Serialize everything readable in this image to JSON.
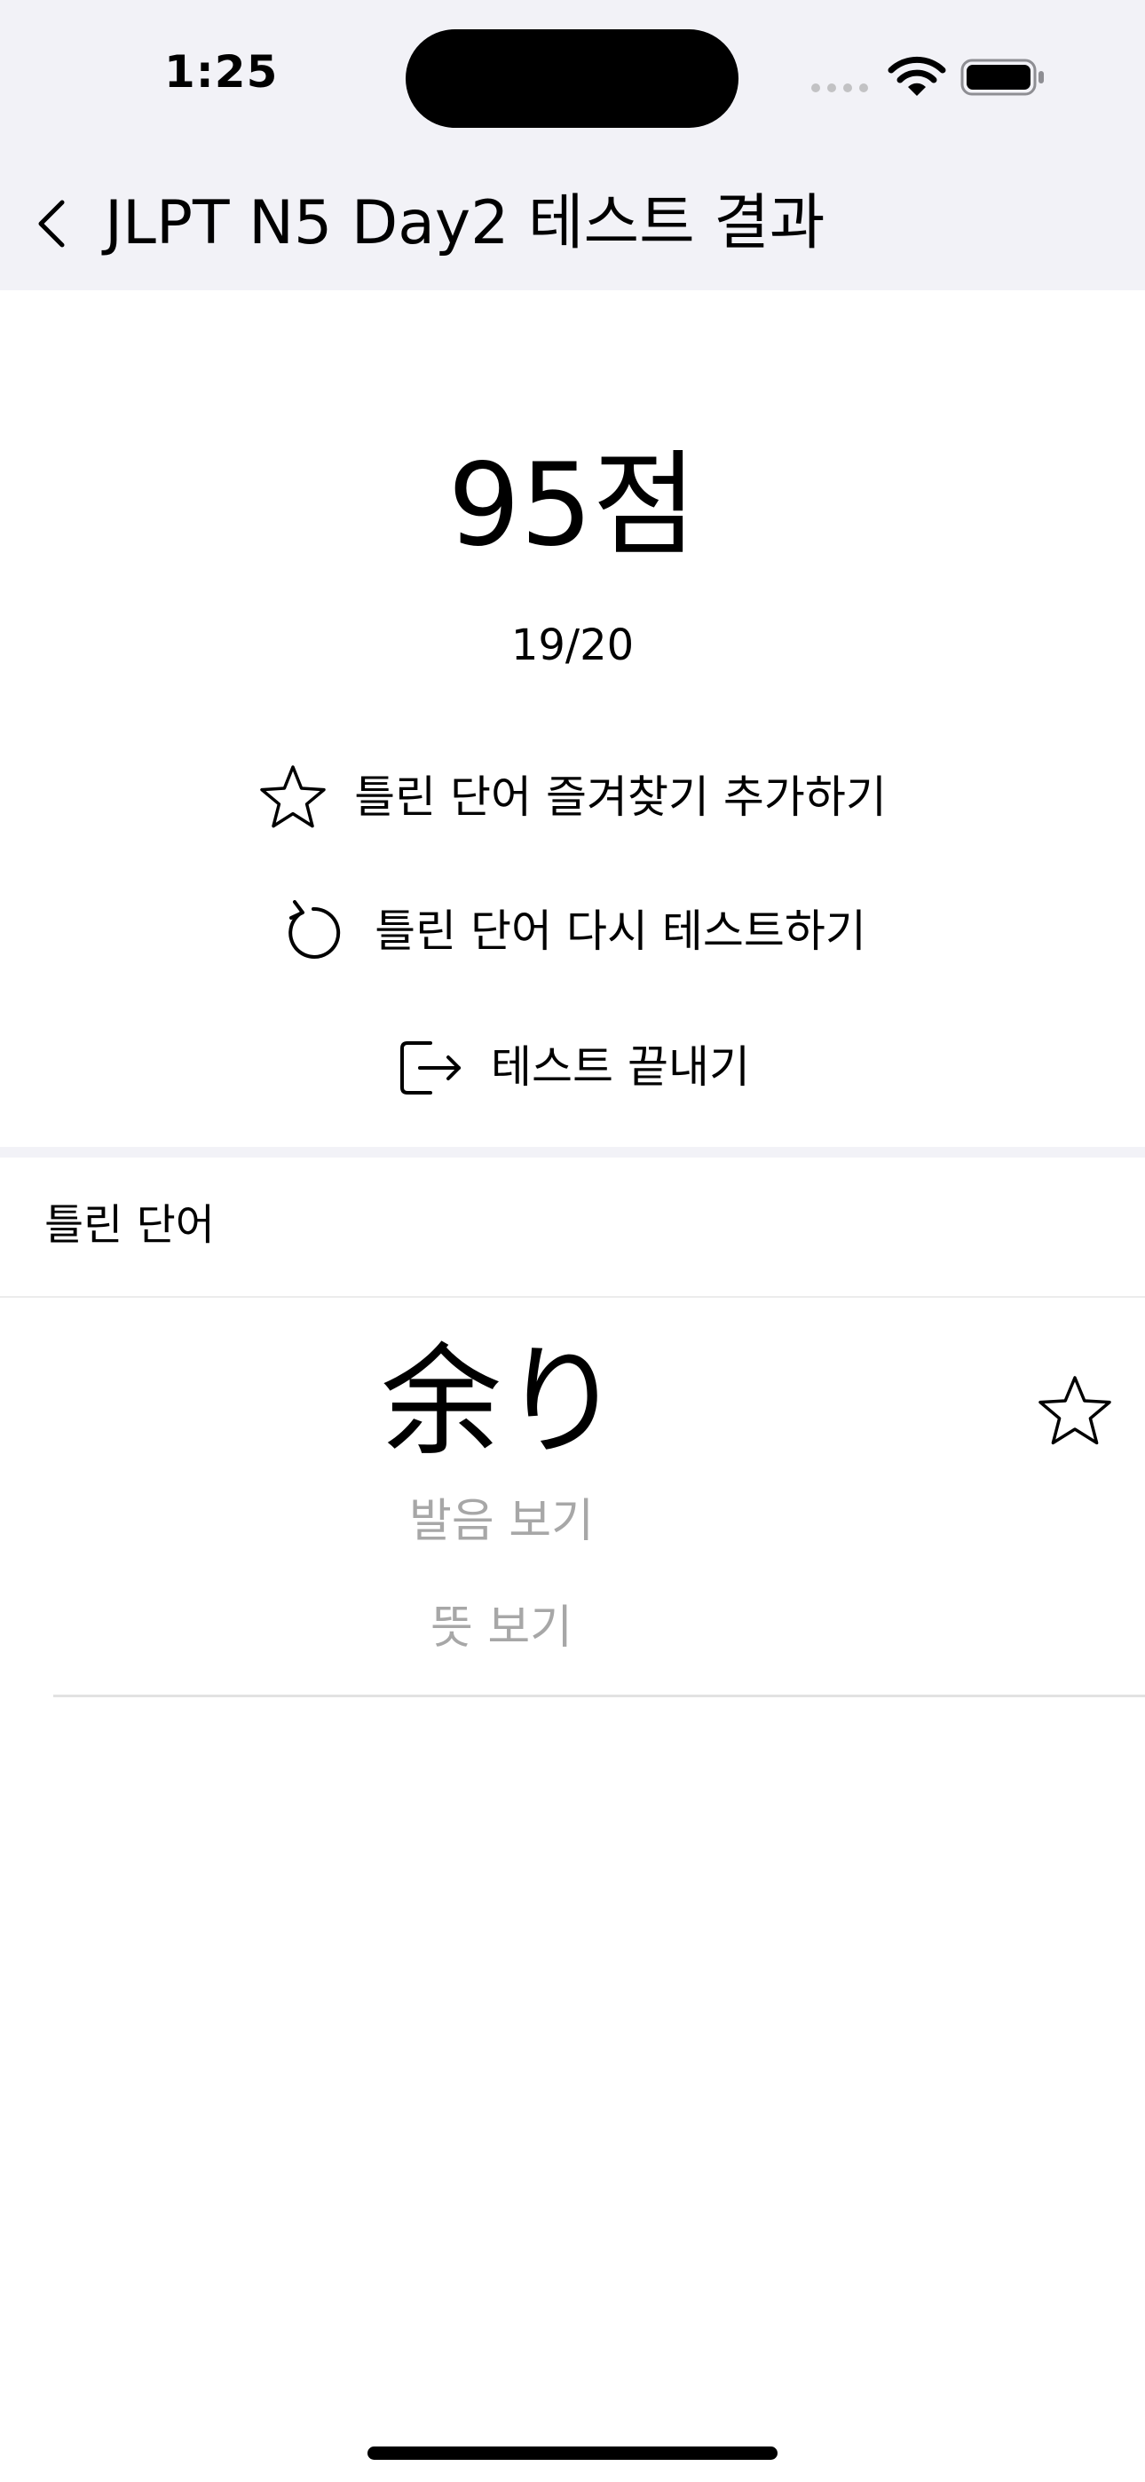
{
  "status_bar": {
    "time": "1:25",
    "icons": [
      "signal-dots-icon",
      "wifi-icon",
      "battery-icon"
    ]
  },
  "nav": {
    "back_icon": "chevron-left-icon",
    "title": "JLPT N5 Day2 테스트 결과"
  },
  "result": {
    "score": "95점",
    "detail": "19/20"
  },
  "actions": {
    "favorite": {
      "label": "틀린 단어 즐겨찾기 추가하기",
      "icon": "star-outline-icon"
    },
    "retry": {
      "label": "틀린 단어 다시 테스트하기",
      "icon": "retry-arrow-icon"
    },
    "end": {
      "label": "테스트 끝내기",
      "icon": "exit-door-icon"
    }
  },
  "wrong_words": {
    "section_title": "틀린 단어",
    "items": [
      {
        "word": "余り",
        "reading_label": "발음 보기",
        "meaning_label": "뜻 보기",
        "favorite_icon": "star-outline-icon"
      }
    ]
  },
  "colors": {
    "header_background": "#f2f2f7",
    "hint_text": "#a7a7a7",
    "text": "#000000"
  }
}
